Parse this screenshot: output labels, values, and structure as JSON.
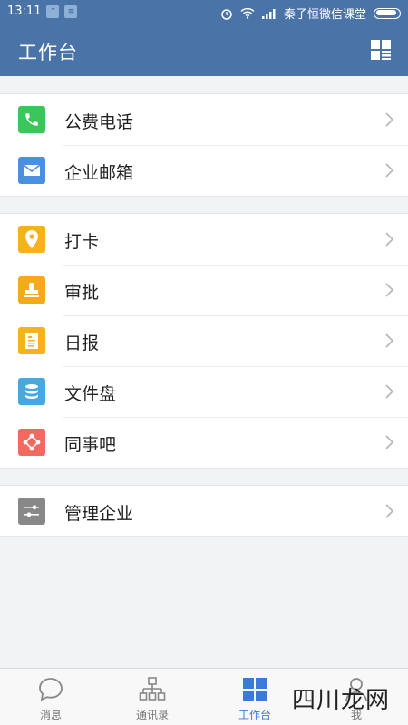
{
  "status": {
    "time": "13:11",
    "carrier": "秦子恒微信课堂"
  },
  "header": {
    "title": "工作台"
  },
  "groups": [
    [
      {
        "label": "公费电话",
        "icon": "phone-icon",
        "color": "#3cc55a"
      },
      {
        "label": "企业邮箱",
        "icon": "mail-icon",
        "color": "#4a90e2"
      }
    ],
    [
      {
        "label": "打卡",
        "icon": "location-pin-icon",
        "color": "#f5b21c"
      },
      {
        "label": "审批",
        "icon": "stamp-icon",
        "color": "#f5a91c"
      },
      {
        "label": "日报",
        "icon": "report-icon",
        "color": "#f5b21c"
      },
      {
        "label": "文件盘",
        "icon": "database-icon",
        "color": "#45a8de"
      },
      {
        "label": "同事吧",
        "icon": "share-icon",
        "color": "#f26a5f"
      }
    ],
    [
      {
        "label": "管理企业",
        "icon": "sliders-icon",
        "color": "#888888"
      }
    ]
  ],
  "tabs": [
    {
      "label": "消息",
      "icon": "chat-bubble-icon",
      "active": false
    },
    {
      "label": "通讯录",
      "icon": "org-chart-icon",
      "active": false
    },
    {
      "label": "工作台",
      "icon": "grid-icon",
      "active": true
    },
    {
      "label": "我",
      "icon": "person-icon",
      "active": false
    }
  ],
  "watermark": "四川龙网"
}
